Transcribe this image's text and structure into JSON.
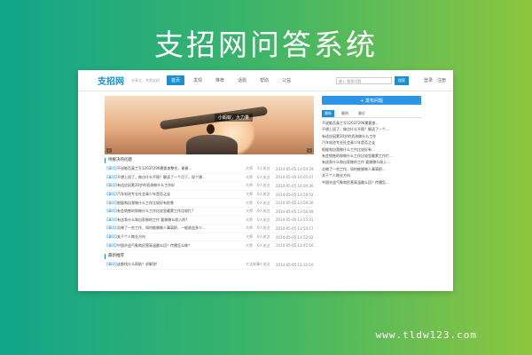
{
  "banner": {
    "title": "支招网问答系统",
    "watermark": "www.tldw123.com"
  },
  "header": {
    "logo": "支招网",
    "slogan": "分享之，共同支招",
    "nav": [
      "首页",
      "发现",
      "推荐",
      "话题",
      "帮助",
      "公益"
    ],
    "search_placeholder": "输入 搜索问题",
    "search_button": "搜索",
    "login": "登录",
    "register": "注册"
  },
  "hero": {
    "caption": "小蚂蚁，大力量",
    "prev": "‹",
    "next": "›"
  },
  "latest": {
    "title": "待解决的问题",
    "rows": [
      {
        "cat": "【事项】",
        "title": "不说能否真工号12037296需要查整合，谢谢...",
        "user": "大师",
        "answers": "1人关注",
        "time": "2014-05-05 13:50:29"
      },
      {
        "cat": "【事项】",
        "title": "不想上班了，做点什么平稳？解读了一个月了，现个建...",
        "user": "大师",
        "answers": "0人关注",
        "time": "2014-05-05 14:05:07"
      },
      {
        "cat": "【事项】",
        "title": "有适应因素30岁的男孩做什么工作好",
        "user": "大师",
        "answers": "0人关注",
        "time": "2014-05-05 14:00:30"
      },
      {
        "cat": "【事项】",
        "title": "汽车电池专业社会青少年是否之谈",
        "user": "大师",
        "answers": "0人关注",
        "time": "2014-05-05 13:59:52"
      },
      {
        "cat": "【事项】",
        "title": "根据和自我做什么工作比较好有前景",
        "user": "大师",
        "answers": "0人关注",
        "time": "2014-05-05 13:58:30"
      },
      {
        "cat": "【事项】",
        "title": "有会销售的和做什么工作比较里最累工作比较忙？",
        "user": "大师",
        "answers": "0人关注",
        "time": "2014-05-05 13:56:49"
      },
      {
        "cat": "【事项】",
        "title": "有这条什么和自家做的工作 要做做么收入的?",
        "user": "大师",
        "answers": "0人关注",
        "time": "2014-05-05 13:55:31"
      },
      {
        "cat": "【事项】",
        "title": "总做了一些工作，如何能够做人事离职，一般收益多少...",
        "user": "大师",
        "answers": "0人关注",
        "time": "2014-05-05 13:54:17"
      },
      {
        "cat": "【事项】",
        "title": "关于个人做业方向",
        "user": "大师",
        "answers": "0人关注",
        "time": "2014-05-05 13:52:02"
      },
      {
        "cat": "【事项】",
        "title": "中国许益气象和民营高温最么回？传播怎么做？",
        "user": "大师",
        "answers": "0人关注",
        "time": "2014-05-05 13:45:16"
      }
    ]
  },
  "recommended": {
    "title": "最新推荐",
    "rows": [
      {
        "cat": "【事项】",
        "title": "这都找什么帮助？求解答!",
        "user": "大法知乎",
        "answers": "3人关注",
        "time": "2014-05-05 13:12:10"
      }
    ]
  },
  "sidebar": {
    "ask_button": "+ 发布问题",
    "tabs": [
      "最新",
      "最热",
      "最近"
    ],
    "items": [
      "不说能否真工号12037296需要查...",
      "不想上班了，做点什么平稳？解读了一个...",
      "有适应因素30岁的男孩做什么工作",
      "汽车电池专业社会青少年是否之谈",
      "根据和自我做什么工作比较好有...",
      "有会销售的和做什么工作比较里最累工作忙...",
      "有这条什么和自家做的工作 要做做么收入...",
      "总做了一些工作，如何能够做人事离职...",
      "关于个人做业方向",
      "中国许益气象和民营高温最么回？传播怎..."
    ]
  },
  "colors": {
    "accent": "#1a8fd6",
    "ask_button": "#2d95e6",
    "gradient_start": "#12a58a",
    "gradient_end": "#8cc63f"
  }
}
